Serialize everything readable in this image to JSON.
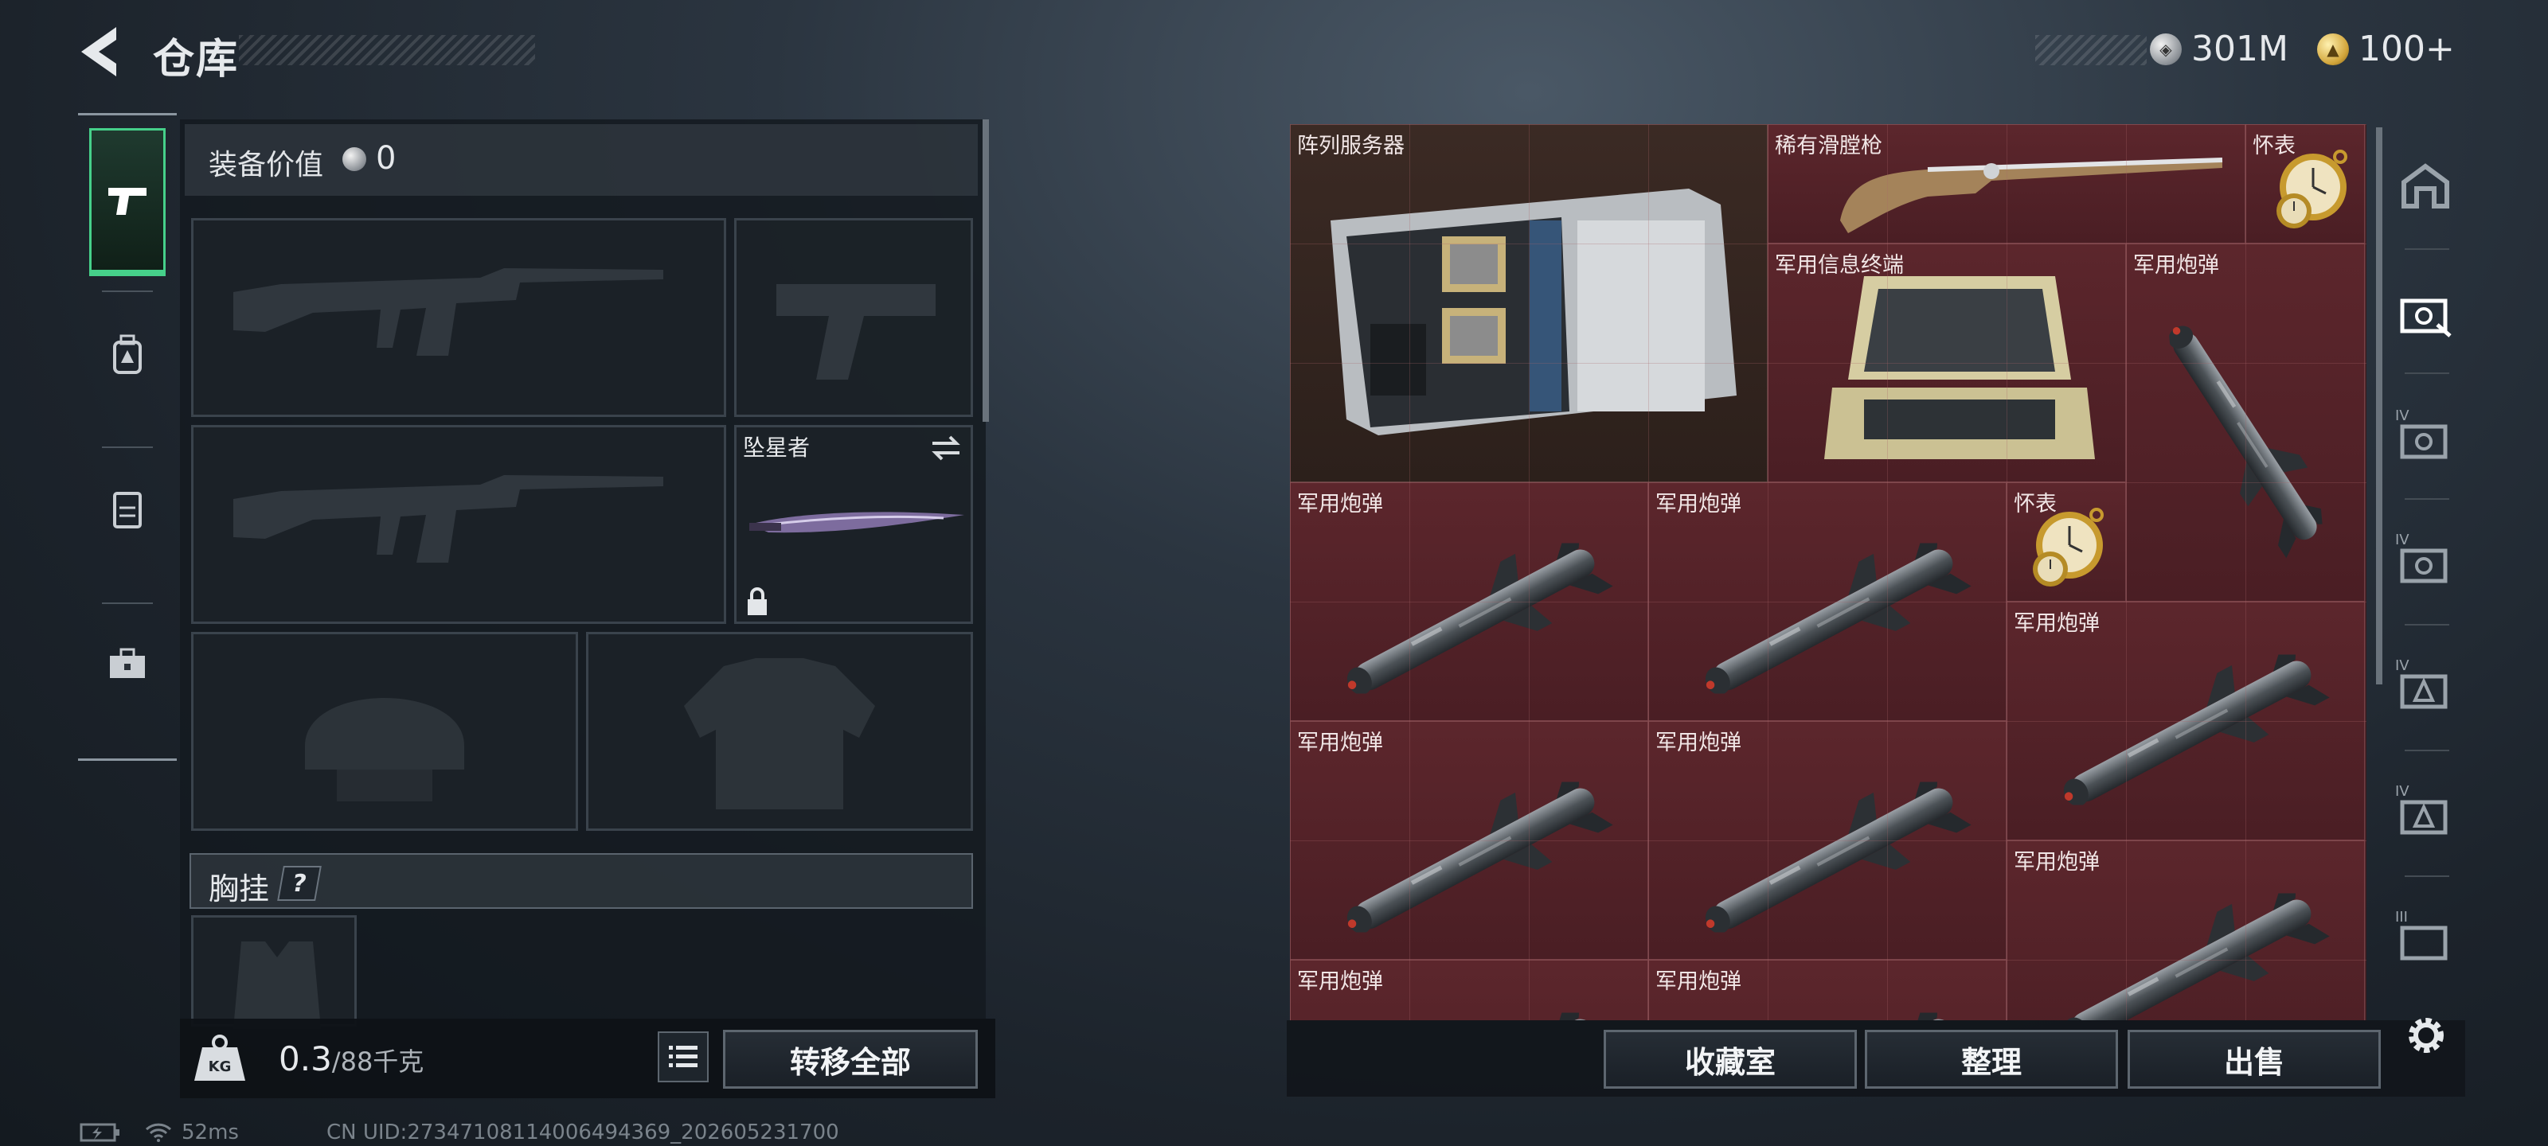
{
  "header": {
    "title": "仓库"
  },
  "currency": [
    {
      "icon": "silver-coin-icon",
      "value": "301M"
    },
    {
      "icon": "gold-coin-icon",
      "value": "100+"
    }
  ],
  "left_tabs": [
    "pistol-icon",
    "backpack-icon",
    "vest-icon",
    "toolbox-icon"
  ],
  "equipment": {
    "value_label": "装备价值",
    "value": "0",
    "melee_slot_label": "坠星者",
    "chest_rig_label": "胸挂",
    "help_label": "?"
  },
  "bottom_left": {
    "weight_current": "0.3",
    "weight_max": "/88千克",
    "kg_label": "KG",
    "transfer_all": "转移全部"
  },
  "storage_items": [
    {
      "name": "阵列服务器",
      "kind": "server"
    },
    {
      "name": "稀有滑膛枪",
      "kind": "musket"
    },
    {
      "name": "怀表",
      "kind": "watch"
    },
    {
      "name": "军用信息终端",
      "kind": "terminal"
    },
    {
      "name": "军用炮弹",
      "kind": "missile"
    },
    {
      "name": "军用炮弹",
      "kind": "missile"
    },
    {
      "name": "军用炮弹",
      "kind": "missile"
    },
    {
      "name": "怀表",
      "kind": "watch"
    },
    {
      "name": "军用炮弹",
      "kind": "missile"
    },
    {
      "name": "军用炮弹",
      "kind": "missile"
    },
    {
      "name": "军用炮弹",
      "kind": "missile"
    },
    {
      "name": "军用炮弹",
      "kind": "missile"
    },
    {
      "name": "军用炮弹",
      "kind": "missile"
    },
    {
      "name": "军用炮弹",
      "kind": "missile"
    }
  ],
  "right_tabs": [
    {
      "icon": "storage-icon",
      "level": ""
    },
    {
      "icon": "case-icon",
      "level": ""
    },
    {
      "icon": "case-icon",
      "level": "IV"
    },
    {
      "icon": "case-icon",
      "level": "IV"
    },
    {
      "icon": "case-icon",
      "level": "IV"
    },
    {
      "icon": "case-icon",
      "level": "IV"
    },
    {
      "icon": "case-icon",
      "level": "III"
    }
  ],
  "actions": {
    "collection": "收藏室",
    "sort": "整理",
    "sell": "出售"
  },
  "status_bar": {
    "ping": "52ms",
    "uid": "CN UID:27347108114006494369_202605231700"
  }
}
